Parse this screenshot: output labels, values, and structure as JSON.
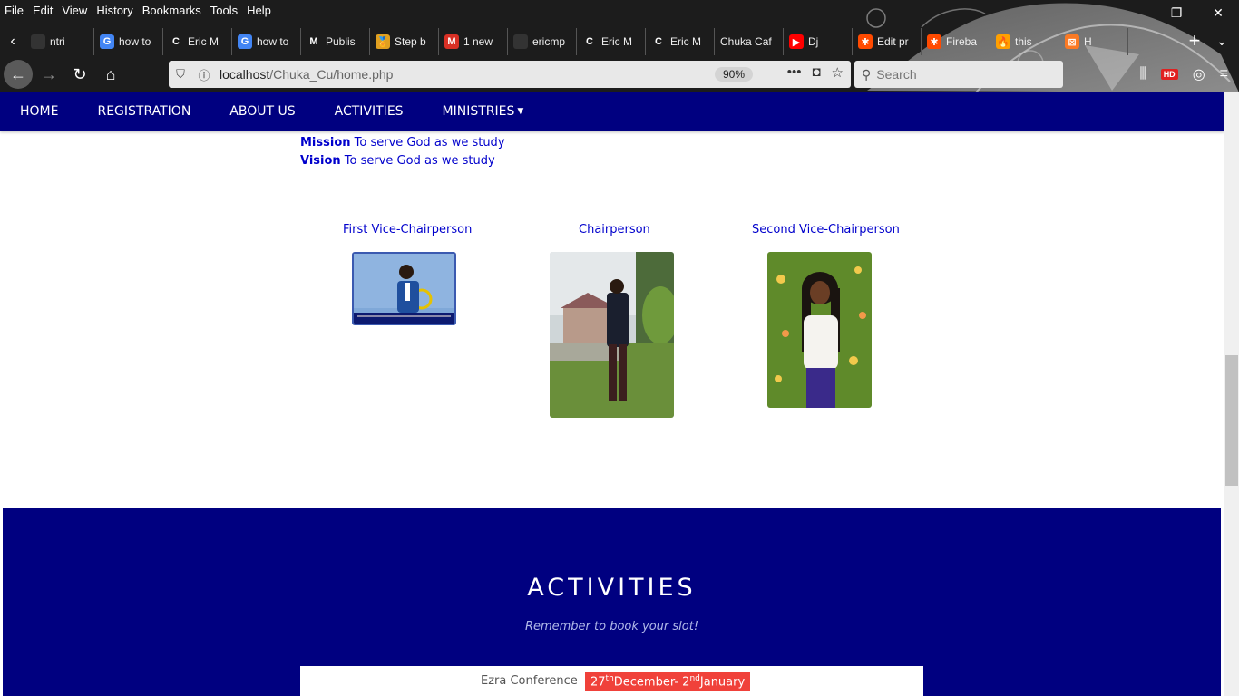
{
  "browser": {
    "menu": [
      "File",
      "Edit",
      "View",
      "History",
      "Bookmarks",
      "Tools",
      "Help"
    ],
    "window_controls": [
      "—",
      "❐",
      "✕"
    ],
    "tabs": [
      {
        "label": "ntri",
        "icon": "generic-page-icon",
        "color": "#333333",
        "glyph": ""
      },
      {
        "label": "how to",
        "icon": "google-icon",
        "color": "#4285f4",
        "glyph": "G"
      },
      {
        "label": "Eric M",
        "icon": "c-icon",
        "color": "#1c1c1c",
        "glyph": "C"
      },
      {
        "label": "how to",
        "icon": "google-icon",
        "color": "#4285f4",
        "glyph": "G"
      },
      {
        "label": "Publis",
        "icon": "medium-icon",
        "color": "#1c1c1c",
        "glyph": "M"
      },
      {
        "label": "Step b",
        "icon": "medal-icon",
        "color": "#e0a020",
        "glyph": "🏅"
      },
      {
        "label": "1 new",
        "icon": "gmail-icon",
        "color": "#d93025",
        "glyph": "M"
      },
      {
        "label": "ericmp",
        "icon": "github-icon",
        "color": "#333333",
        "glyph": ""
      },
      {
        "label": "Eric M",
        "icon": "c-icon",
        "color": "#1c1c1c",
        "glyph": "C"
      },
      {
        "label": "Eric M",
        "icon": "c-icon",
        "color": "#1c1c1c",
        "glyph": "C"
      },
      {
        "label": "Chuka Caf",
        "icon": "none",
        "color": "#1c1c1c",
        "glyph": ""
      },
      {
        "label": "Dj",
        "icon": "youtube-icon",
        "color": "#ff0000",
        "glyph": "▶"
      },
      {
        "label": "Edit pr",
        "icon": "zapier-icon",
        "color": "#ff4a00",
        "glyph": "✱"
      },
      {
        "label": "Fireba",
        "icon": "zapier-icon",
        "color": "#ff4a00",
        "glyph": "✱"
      },
      {
        "label": "this",
        "icon": "firebase-icon",
        "color": "#ffa000",
        "glyph": "🔥"
      },
      {
        "label": "H",
        "icon": "xampp-icon",
        "color": "#fb7a24",
        "glyph": "⊠"
      }
    ],
    "url_host": "localhost",
    "url_path": "/Chuka_Cu/home.php",
    "zoom": "90%",
    "search_placeholder": "Search",
    "hd_badge": "HD"
  },
  "site": {
    "nav": [
      "HOME",
      "REGISTRATION",
      "ABOUT US",
      "ACTIVITIES",
      "MINISTRIES"
    ],
    "mission_label": "Mission",
    "mission_text": " To serve God as we study",
    "vision_label": "Vision",
    "vision_text": " To serve God as we study",
    "leaders": [
      {
        "title": "First Vice-Chairperson"
      },
      {
        "title": "Chairperson"
      },
      {
        "title": "Second Vice-Chairperson"
      }
    ],
    "activities": {
      "title": "ACTIVITIES",
      "subtitle": "Remember to book your slot!",
      "event_name": "Ezra Conference",
      "date_part1": "27",
      "date_sup1": "th",
      "date_part2": "December- 2",
      "date_sup2": "nd",
      "date_part3": "January"
    }
  },
  "colors": {
    "nav_bg": "#000080",
    "link": "#0000cc",
    "date_badge": "#f0413a"
  }
}
